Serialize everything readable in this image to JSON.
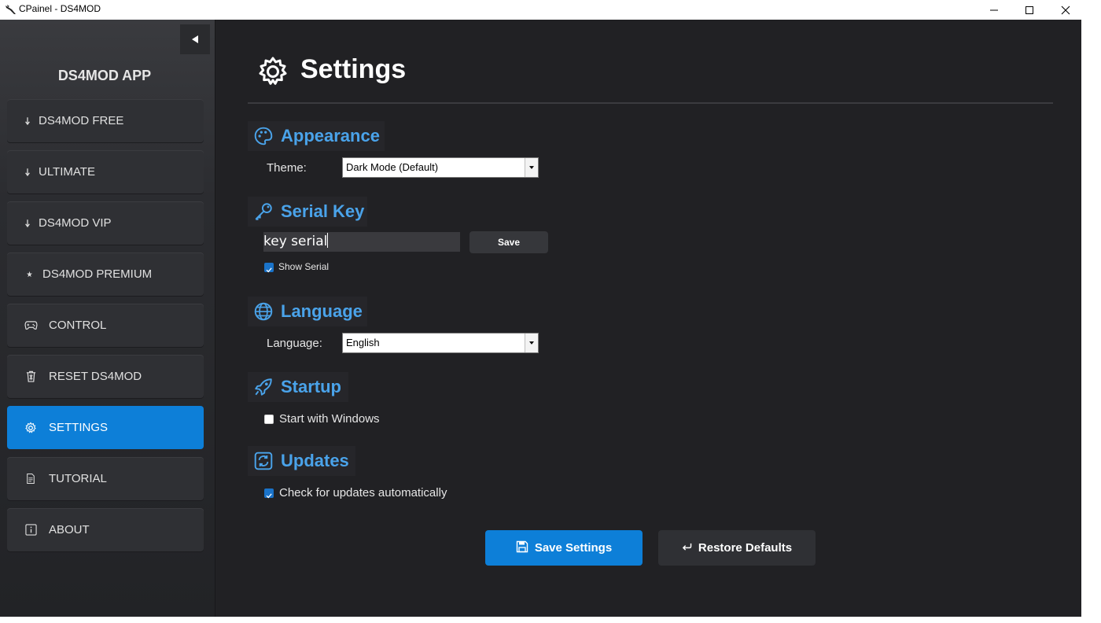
{
  "window": {
    "title": "CPainel - DS4MOD"
  },
  "sidebar": {
    "app_title": "DS4MOD APP",
    "items": [
      {
        "label": "DS4MOD FREE",
        "icon": "download-arrow-icon"
      },
      {
        "label": "ULTIMATE",
        "icon": "download-arrow-icon"
      },
      {
        "label": "DS4MOD VIP",
        "icon": "download-arrow-icon"
      },
      {
        "label": "DS4MOD PREMIUM",
        "icon": "star-icon"
      },
      {
        "label": "CONTROL",
        "icon": "gamepad-icon"
      },
      {
        "label": "RESET DS4MOD",
        "icon": "trash-icon"
      },
      {
        "label": "SETTINGS",
        "icon": "gear-icon",
        "active": true
      },
      {
        "label": "TUTORIAL",
        "icon": "document-icon"
      },
      {
        "label": "ABOUT",
        "icon": "info-icon"
      }
    ]
  },
  "main": {
    "title": "Settings",
    "appearance": {
      "heading": "Appearance",
      "theme_label": "Theme:",
      "theme_value": "Dark Mode (Default)"
    },
    "serial_key": {
      "heading": "Serial Key",
      "input_value": "key serial",
      "save_label": "Save",
      "show_serial_label": "Show Serial",
      "show_serial_checked": true
    },
    "language": {
      "heading": "Language",
      "language_label": "Language:",
      "language_value": "English"
    },
    "startup": {
      "heading": "Startup",
      "start_with_windows_label": "Start with Windows",
      "start_with_windows_checked": false
    },
    "updates": {
      "heading": "Updates",
      "auto_check_label": "Check for updates automatically",
      "auto_check_checked": true
    },
    "actions": {
      "save_settings_label": "Save Settings",
      "restore_defaults_label": "Restore Defaults"
    }
  },
  "colors": {
    "accent": "#0d7fd8",
    "heading_blue": "#4aa3ea",
    "background": "#212124",
    "sidebar_item": "#2f3034"
  }
}
